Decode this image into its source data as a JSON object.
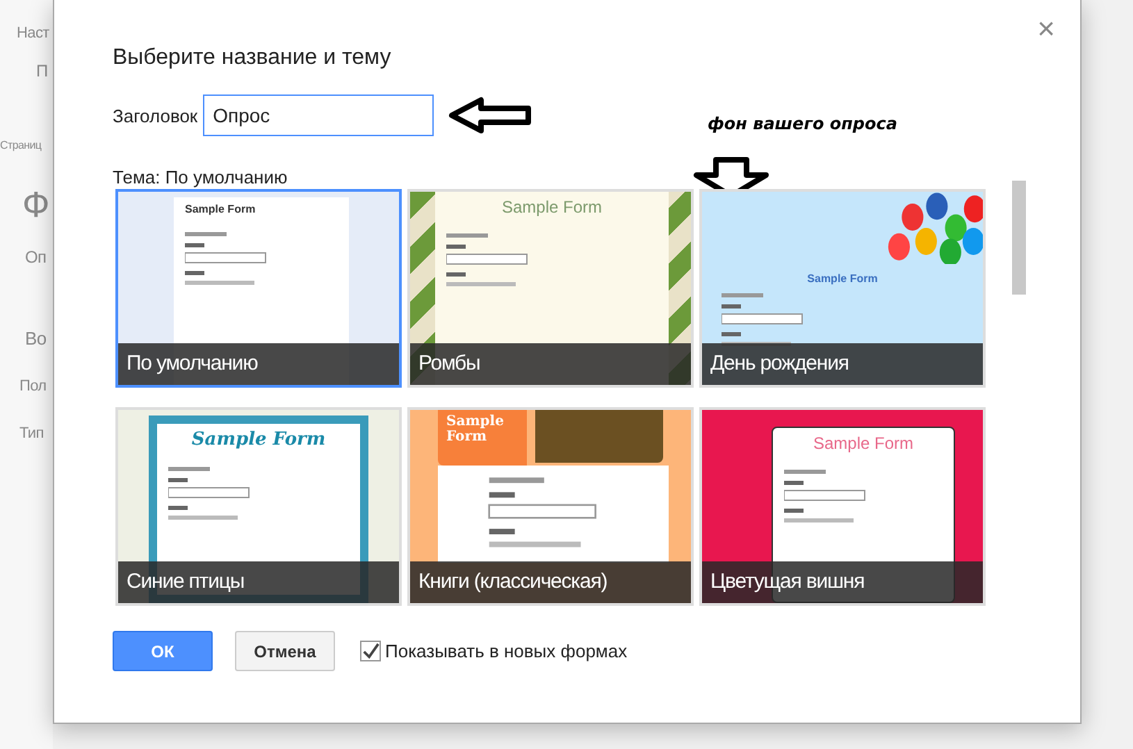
{
  "background": {
    "items": [
      "Наст",
      "П",
      "Страниц",
      "Ф",
      "Оп",
      "Во",
      "Пол",
      "Тип"
    ]
  },
  "dialog": {
    "title": "Выберите название и тему",
    "close": "×",
    "title_field": {
      "label": "Заголовок",
      "value": "Опрос"
    },
    "theme_label": "Тема: По умолчанию",
    "annotation": "фон вашего опроса",
    "themes": [
      {
        "kind": "default",
        "name": "По умолчанию",
        "preview_title": "Sample Form",
        "selected": true
      },
      {
        "kind": "diamonds",
        "name": "Ромбы",
        "preview_title": "Sample Form",
        "selected": false
      },
      {
        "kind": "birthday",
        "name": "День рождения",
        "preview_title": "Sample Form",
        "selected": false
      },
      {
        "kind": "birds",
        "name": "Синие птицы",
        "preview_title": "Sample Form",
        "selected": false
      },
      {
        "kind": "books",
        "name": "Книги (классическая)",
        "preview_title": "Sample Form",
        "selected": false
      },
      {
        "kind": "cherry",
        "name": "Цветущая вишня",
        "preview_title": "Sample Form",
        "selected": false
      }
    ],
    "ok": "ОК",
    "cancel": "Отмена",
    "show_in_new_forms": {
      "label": "Показывать в новых формах",
      "checked": true
    }
  }
}
